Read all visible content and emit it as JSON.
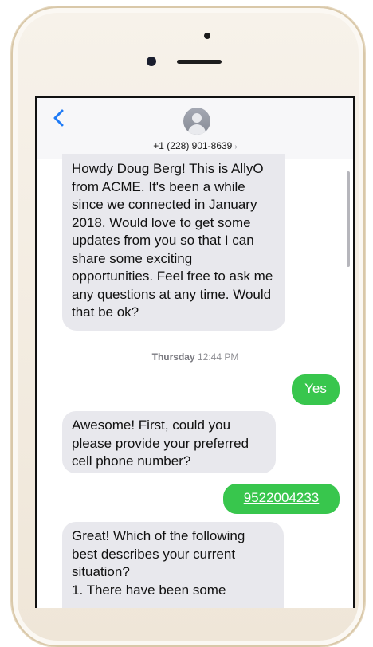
{
  "header": {
    "back_icon": "chevron-left-icon",
    "avatar_icon": "contact-avatar-icon",
    "contact_number": "+1 (228) 901-8639",
    "chevron": "›"
  },
  "conversation": {
    "messages": [
      {
        "from": "incoming",
        "text": "Howdy Doug Berg! This is AllyO from ACME. It's been a while since we connected in January 2018. Would love to get some updates from you so that I can share some exciting opportunities. Feel free to ask me any questions at any time. Would that be ok?"
      },
      {
        "from": "outgoing",
        "text": "Yes"
      },
      {
        "from": "incoming",
        "text": "Awesome! First, could you please provide your preferred cell phone number?"
      },
      {
        "from": "outgoing",
        "text": "9522004233"
      },
      {
        "from": "incoming",
        "text": "Great! Which of the following best describes your current situation?\n1. There have been some"
      }
    ],
    "timestamp_day": "Thursday",
    "timestamp_time": "12:44 PM"
  },
  "colors": {
    "outgoing_bubble": "#38c64d",
    "incoming_bubble": "#e8e8ed",
    "accent_blue": "#1f7bf6"
  }
}
